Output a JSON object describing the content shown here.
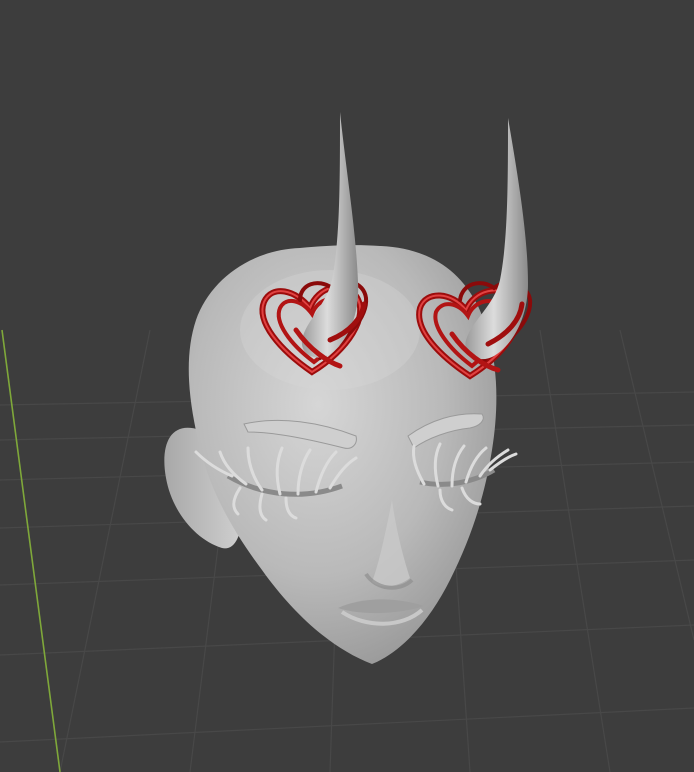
{
  "viewport": {
    "kind": "3d-viewport",
    "background_color": "#3d3d3d",
    "grid_color": "#4a4a4a",
    "y_axis_color": "#8fbf3a"
  },
  "model": {
    "subject": "head",
    "skin_color": "#b8b8b8",
    "horn_color": "#c4c4c4",
    "heart_ring_color": "#b01010",
    "heart_ring_highlight": "#ff5a5a",
    "lash_color": "#d9d9d9",
    "icons": [
      "head-sculpt",
      "horn",
      "heart-ring",
      "eyelash",
      "eyebrow"
    ]
  }
}
